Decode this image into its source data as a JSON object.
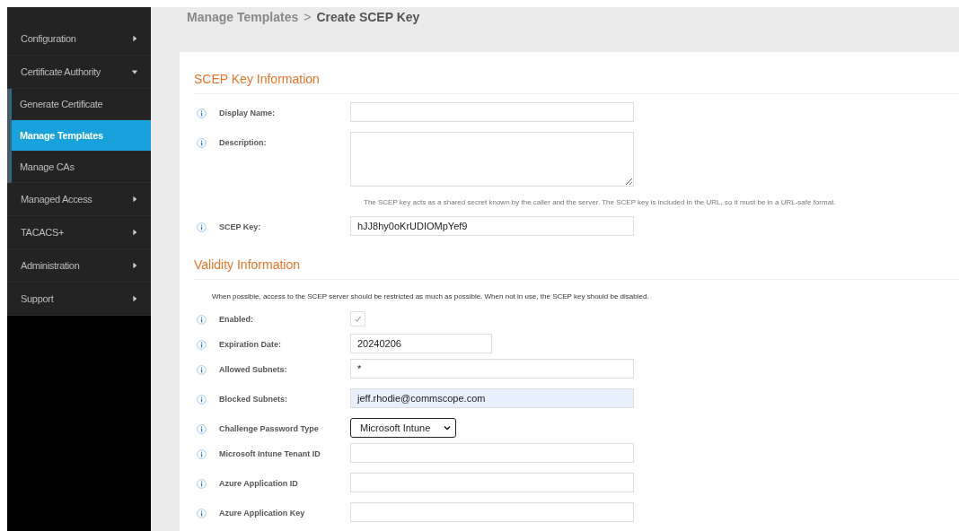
{
  "sidebar": {
    "items": [
      {
        "label": "Configuration",
        "expanded": false
      },
      {
        "label": "Certificate Authority",
        "expanded": true,
        "children": [
          {
            "label": "Generate Certificate",
            "selected": false
          },
          {
            "label": "Manage Templates",
            "selected": true
          },
          {
            "label": "Manage CAs",
            "selected": false
          }
        ]
      },
      {
        "label": "Managed Access",
        "expanded": false
      },
      {
        "label": "TACACS+",
        "expanded": false
      },
      {
        "label": "Administration",
        "expanded": false
      },
      {
        "label": "Support",
        "expanded": false
      }
    ]
  },
  "breadcrumb": {
    "parent": "Manage Templates",
    "separator": ">",
    "current": "Create SCEP Key"
  },
  "sections": [
    {
      "title": "SCEP Key Information",
      "rows": [
        {
          "kind": "text",
          "label": "Display Name:",
          "value": ""
        },
        {
          "kind": "textarea",
          "label": "Description:",
          "value": ""
        },
        {
          "kind": "note",
          "text": "The SCEP key acts as a shared secret known by the caller and the server. The SCEP key is included in the URL, so it must be in a URL-safe format."
        },
        {
          "kind": "text",
          "label": "SCEP Key:",
          "value": "hJJ8hy0oKrUDIOMpYef9"
        }
      ]
    },
    {
      "title": "Validity Information",
      "rows": [
        {
          "kind": "intro",
          "text": "When possible, access to the SCEP server should be restricted as much as possible. When not in use, the SCEP key should be disabled."
        },
        {
          "kind": "checkbox",
          "label": "Enabled:",
          "checked": true
        },
        {
          "kind": "date",
          "label": "Expiration Date:",
          "value": "20240206"
        },
        {
          "kind": "text",
          "label": "Allowed Subnets:",
          "value": "*"
        },
        {
          "kind": "text",
          "label": "Blocked Subnets:",
          "value": "jeff.rhodie@commscope.com",
          "autofilled": true
        },
        {
          "kind": "select",
          "label": "Challenge Password Type",
          "value": "Microsoft Intune"
        },
        {
          "kind": "text",
          "label": "Microsoft Intune Tenant ID",
          "value": ""
        },
        {
          "kind": "text",
          "label": "Azure Application ID",
          "value": ""
        },
        {
          "kind": "text",
          "label": "Azure Application Key",
          "value": ""
        }
      ]
    }
  ]
}
